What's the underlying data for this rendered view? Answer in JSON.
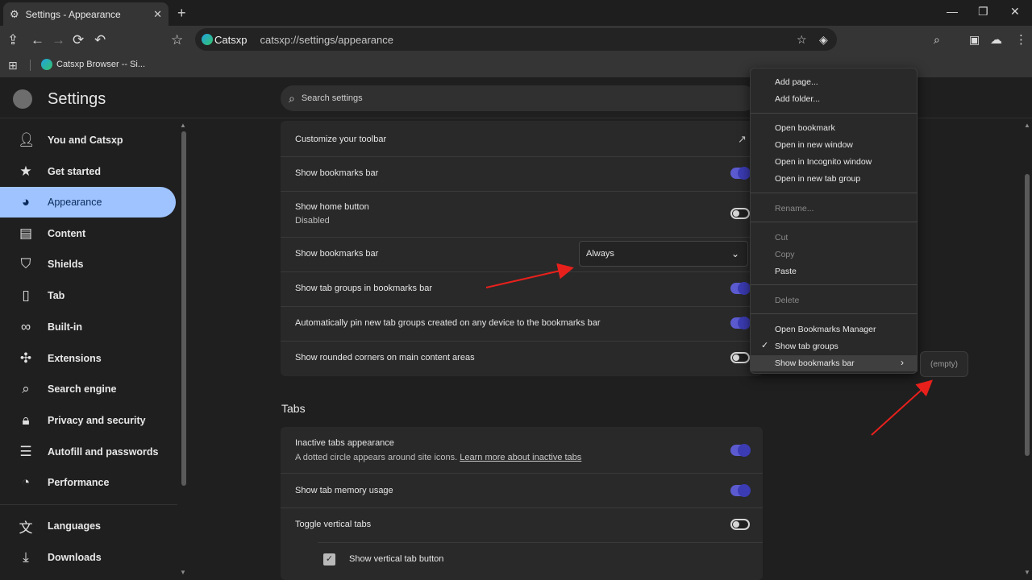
{
  "browser": {
    "tab_title": "Settings - Appearance",
    "omnibox_brand": "Catsxp",
    "url": "catsxp://settings/appearance",
    "bookmark_item": "Catsxp Browser -- Si..."
  },
  "settings": {
    "title": "Settings",
    "search_placeholder": "Search settings"
  },
  "sidebar": {
    "items": [
      {
        "label": "You and Catsxp",
        "icon": "person-icon"
      },
      {
        "label": "Get started",
        "icon": "rocket-icon"
      },
      {
        "label": "Appearance",
        "icon": "palette-icon",
        "active": true
      },
      {
        "label": "Content",
        "icon": "content-icon"
      },
      {
        "label": "Shields",
        "icon": "shield-icon"
      },
      {
        "label": "Tab",
        "icon": "tab-icon"
      },
      {
        "label": "Built-in",
        "icon": "builtin-icon"
      },
      {
        "label": "Extensions",
        "icon": "puzzle-icon"
      },
      {
        "label": "Search engine",
        "icon": "search-icon"
      },
      {
        "label": "Privacy and security",
        "icon": "lock-icon"
      },
      {
        "label": "Autofill and passwords",
        "icon": "list-icon"
      },
      {
        "label": "Performance",
        "icon": "gauge-icon"
      },
      {
        "label": "Languages",
        "icon": "translate-icon"
      },
      {
        "label": "Downloads",
        "icon": "download-icon"
      }
    ]
  },
  "appearance_rows": {
    "customize_toolbar": "Customize your toolbar",
    "show_bookmarks_bar_toggle": "Show bookmarks bar",
    "show_home_button": "Show home button",
    "show_home_button_sub": "Disabled",
    "show_bookmarks_bar_select": "Show bookmarks bar",
    "dropdown_value": "Always",
    "show_tab_groups": "Show tab groups in bookmarks bar",
    "auto_pin": "Automatically pin new tab groups created on any device to the bookmarks bar",
    "rounded_corners": "Show rounded corners on main content areas"
  },
  "tabs_section": {
    "heading": "Tabs",
    "inactive_tabs": "Inactive tabs appearance",
    "inactive_tabs_sub": "A dotted circle appears around site icons.",
    "inactive_tabs_link": "Learn more about inactive tabs",
    "memory_usage": "Show tab memory usage",
    "vertical_tabs": "Toggle vertical tabs",
    "vertical_tab_button": "Show vertical tab button"
  },
  "context_menu": {
    "add_page": "Add page...",
    "add_folder": "Add folder...",
    "open_bookmark": "Open bookmark",
    "open_new_window": "Open in new window",
    "open_incognito": "Open in Incognito window",
    "open_tab_group": "Open in new tab group",
    "rename": "Rename...",
    "cut": "Cut",
    "copy": "Copy",
    "paste": "Paste",
    "delete": "Delete",
    "open_manager": "Open Bookmarks Manager",
    "show_tab_groups": "Show tab groups",
    "show_bookmarks_bar": "Show bookmarks bar",
    "submenu_empty": "(empty)"
  },
  "colors": {
    "accent_active_nav": "#9ec3ff",
    "toggle_on": "#5b5bcf",
    "annotation_arrow": "#e8201c"
  }
}
